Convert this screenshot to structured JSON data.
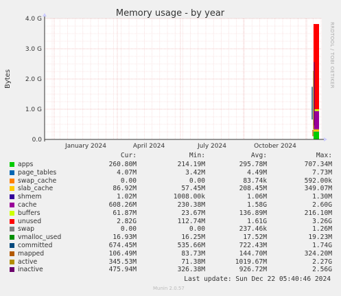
{
  "chart_data": {
    "type": "area",
    "title": "Memory usage - by year",
    "ylabel": "Bytes",
    "yticks": [
      "0.0",
      "1.0 G",
      "2.0 G",
      "3.0 G",
      "4.0 G"
    ],
    "ytick_values": [
      0,
      1,
      2,
      3,
      4
    ],
    "ylim": [
      0,
      4
    ],
    "xticks": [
      "January 2024",
      "April 2024",
      "July 2024",
      "October 2024"
    ],
    "side_label": "RRDTOOL / TOBI OETIKER",
    "grid": true,
    "columns": [
      "Cur:",
      "Min:",
      "Avg:",
      "Max:"
    ],
    "series": [
      {
        "name": "apps",
        "color": "#00cc00",
        "cur": "260.80M",
        "min": "214.19M",
        "avg": "295.78M",
        "max": "707.34M"
      },
      {
        "name": "page_tables",
        "color": "#0066b3",
        "cur": "4.07M",
        "min": "3.42M",
        "avg": "4.49M",
        "max": "7.73M"
      },
      {
        "name": "swap_cache",
        "color": "#ff8000",
        "cur": "0.00",
        "min": "0.00",
        "avg": "83.74k",
        "max": "592.00k"
      },
      {
        "name": "slab_cache",
        "color": "#ffcc00",
        "cur": "86.92M",
        "min": "57.45M",
        "avg": "208.45M",
        "max": "349.07M"
      },
      {
        "name": "shmem",
        "color": "#330099",
        "cur": "1.02M",
        "min": "1008.00k",
        "avg": "1.06M",
        "max": "1.30M"
      },
      {
        "name": "cache",
        "color": "#990099",
        "cur": "608.26M",
        "min": "230.38M",
        "avg": "1.58G",
        "max": "2.60G"
      },
      {
        "name": "buffers",
        "color": "#ccff00",
        "cur": "61.87M",
        "min": "23.67M",
        "avg": "136.89M",
        "max": "216.10M"
      },
      {
        "name": "unused",
        "color": "#ff0000",
        "cur": "2.82G",
        "min": "112.74M",
        "avg": "1.61G",
        "max": "3.26G"
      },
      {
        "name": "swap",
        "color": "#808080",
        "cur": "0.00",
        "min": "0.00",
        "avg": "237.46k",
        "max": "1.26M"
      },
      {
        "name": "vmalloc_used",
        "color": "#008f00",
        "cur": "16.93M",
        "min": "16.25M",
        "avg": "17.52M",
        "max": "19.23M"
      },
      {
        "name": "committed",
        "color": "#00487d",
        "cur": "674.45M",
        "min": "535.66M",
        "avg": "722.43M",
        "max": "1.74G"
      },
      {
        "name": "mapped",
        "color": "#b35a00",
        "cur": "106.49M",
        "min": "83.73M",
        "avg": "144.70M",
        "max": "324.20M"
      },
      {
        "name": "active",
        "color": "#b38f00",
        "cur": "345.53M",
        "min": "71.38M",
        "avg": "1019.67M",
        "max": "2.27G"
      },
      {
        "name": "inactive",
        "color": "#6b006b",
        "cur": "475.94M",
        "min": "326.38M",
        "avg": "926.72M",
        "max": "2.56G"
      }
    ],
    "last_update": "Last update: Sun Dec 22 05:40:46 2024",
    "footer": "Munin 2.0.57"
  }
}
